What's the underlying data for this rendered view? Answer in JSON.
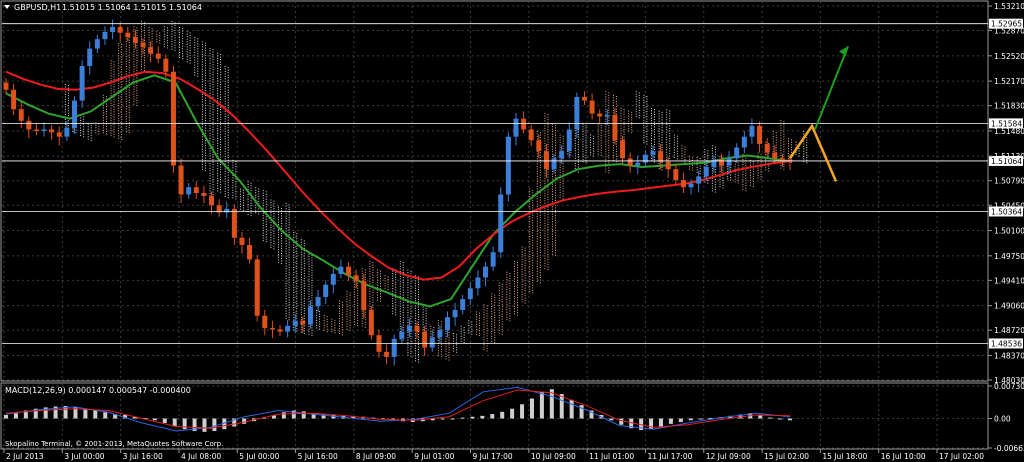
{
  "header": {
    "symbol": "GBPUSD,H1",
    "ohlc": "1.51015 1.51064 1.51015 1.51064",
    "macd": "MACD(12,26,9) 0.000147 0.000547 -0.000400"
  },
  "footer": {
    "copyright": "Skopalino Terminal, © 2001-2013, MetaQuotes Software Corp."
  },
  "colors": {
    "background": "#000000",
    "grid": "#3c3c3c",
    "up_candle": "#3c7fd8",
    "down_candle": "#e0521c",
    "ma_red": "#ee1c1c",
    "ma_green": "#2ea32e",
    "cloud_orange": "#e8b08c",
    "cloud_white": "#dcdcdc",
    "forecast_orange": "#f5a623",
    "arrow_green": "#1ea01e",
    "macd_hist": "#cfcfcf",
    "macd_signal": "#e02020",
    "macd_main": "#2c66e0",
    "level_line": "#ffffff"
  },
  "chart_data": [
    {
      "type": "candlestick",
      "title": "GBPUSD,H1",
      "y_ticks": [
        "1.53210",
        "1.52870",
        "1.52520",
        "1.52170",
        "1.51830",
        "1.51480",
        "1.51130",
        "1.50790",
        "1.50450",
        "1.50100",
        "1.49750",
        "1.49410",
        "1.49060",
        "1.48720",
        "1.48370",
        "1.48030"
      ],
      "ylim": [
        1.4803,
        1.5321
      ],
      "price_labels": [
        "1.52965",
        "1.51584",
        "1.51064",
        "1.50364",
        "1.48536"
      ],
      "x_ticks": [
        "2 Jul 2013",
        "3 Jul 00:00",
        "3 Jul 16:00",
        "4 Jul 08:00",
        "5 Jul 00:00",
        "5 Jul 16:00",
        "8 Jul 09:00",
        "9 Jul 01:00",
        "9 Jul 17:00",
        "10 Jul 09:00",
        "11 Jul 01:00",
        "11 Jul 17:00",
        "12 Jul 09:00",
        "15 Jul 02:00",
        "15 Jul 18:00",
        "16 Jul 10:00",
        "17 Jul 02:00"
      ],
      "close_path": [
        1.5205,
        1.5178,
        1.5162,
        1.515,
        1.5148,
        1.515,
        1.5146,
        1.514,
        1.5152,
        1.519,
        1.5238,
        1.5262,
        1.5275,
        1.5285,
        1.5292,
        1.5284,
        1.5278,
        1.527,
        1.5264,
        1.5255,
        1.5248,
        1.523,
        1.51,
        1.506,
        1.507,
        1.5062,
        1.5058,
        1.5045,
        1.5035,
        1.504,
        1.5,
        1.499,
        1.497,
        1.4892,
        1.4875,
        1.4873,
        1.487,
        1.4878,
        1.4885,
        1.488,
        1.4905,
        1.4918,
        1.4935,
        1.495,
        1.496,
        1.4948,
        1.494,
        1.49,
        1.4865,
        1.4842,
        1.4835,
        1.486,
        1.487,
        1.4878,
        1.487,
        1.4848,
        1.4862,
        1.4872,
        1.489,
        1.49,
        1.4915,
        1.493,
        1.4945,
        1.496,
        1.498,
        1.506,
        1.514,
        1.5165,
        1.515,
        1.5135,
        1.512,
        1.5095,
        1.511,
        1.512,
        1.515,
        1.5195,
        1.519,
        1.5172,
        1.5168,
        1.517,
        1.5135,
        1.511,
        1.51,
        1.5104,
        1.5115,
        1.512,
        1.5105,
        1.5095,
        1.508,
        1.507,
        1.5075,
        1.5085,
        1.5098,
        1.5108,
        1.51,
        1.511,
        1.5125,
        1.514,
        1.5155,
        1.513,
        1.5118,
        1.511,
        1.5108,
        1.5106
      ],
      "ma_red": [
        1.523,
        1.522,
        1.5212,
        1.5206,
        1.5205,
        1.5208,
        1.5215,
        1.5224,
        1.523,
        1.5228,
        1.522,
        1.5206,
        1.519,
        1.517,
        1.5146,
        1.512,
        1.5092,
        1.5064,
        1.5038,
        1.5014,
        1.4992,
        1.4974,
        1.4958,
        1.4948,
        1.4942,
        1.4945,
        1.496,
        1.4985,
        1.5005,
        1.5022,
        1.5034,
        1.5044,
        1.5052,
        1.5057,
        1.5061,
        1.5064,
        1.5066,
        1.5069,
        1.5072,
        1.5075,
        1.508,
        1.5087,
        1.5094,
        1.5099,
        1.5103,
        1.5106
      ],
      "ma_green": [
        1.52,
        1.5185,
        1.5172,
        1.5165,
        1.5175,
        1.5195,
        1.5215,
        1.5225,
        1.5215,
        1.516,
        1.511,
        1.508,
        1.5042,
        1.501,
        1.4985,
        1.4968,
        1.495,
        1.4935,
        1.4924,
        1.4912,
        1.4905,
        1.4915,
        1.496,
        1.5005,
        1.5035,
        1.506,
        1.5082,
        1.5095,
        1.51,
        1.5102,
        1.5098,
        1.51,
        1.5102,
        1.5104,
        1.511,
        1.5114,
        1.511,
        1.5106
      ],
      "forecast": {
        "points": [
          1.511,
          1.5155,
          1.5078
        ],
        "arrow": [
          1.515,
          1.5265
        ]
      }
    },
    {
      "type": "bar",
      "title": "MACD(12,26,9) 0.000147 0.000547 -0.000400",
      "y_ticks": [
        "0.007309",
        "0.00",
        "-0.00663"
      ],
      "ylim": [
        -0.00663,
        0.007309
      ],
      "histogram": [
        0.0008,
        0.0012,
        0.0018,
        0.0022,
        0.0025,
        0.0027,
        0.0028,
        0.0026,
        0.0022,
        0.0018,
        0.0014,
        0.001,
        0.0008,
        0.0004,
        0.0001,
        -0.0004,
        -0.001,
        -0.0018,
        -0.0024,
        -0.0028,
        -0.003,
        -0.0028,
        -0.0024,
        -0.0018,
        -0.0012,
        -0.0006,
        0.0002,
        0.0008,
        0.0014,
        0.0018,
        0.0016,
        0.0012,
        0.001,
        0.0008,
        0.0006,
        0.0005,
        0.0004,
        0.0002,
        -0.0002,
        -0.0004,
        -0.0006,
        -0.0008,
        -0.0006,
        -0.0004,
        -0.0002,
        0.0,
        0.0002,
        0.0004,
        0.0006,
        0.001,
        0.0015,
        0.0022,
        0.0032,
        0.0045,
        0.006,
        0.0066,
        0.0055,
        0.0042,
        0.003,
        0.0018,
        0.0008,
        -0.0004,
        -0.0014,
        -0.0022,
        -0.0026,
        -0.0024,
        -0.0018,
        -0.0012,
        -0.0008,
        -0.0004,
        -0.0002,
        0.0001,
        0.0003,
        0.0006,
        0.0009,
        0.0012,
        0.0008,
        0.0002,
        -0.0002,
        -0.0004
      ],
      "main": [
        0.001,
        0.002,
        0.0026,
        0.0014,
        -0.001,
        -0.0028,
        -0.002,
        0.0004,
        0.0018,
        0.001,
        0.0002,
        -0.0006,
        -0.0002,
        0.0012,
        0.006,
        0.007,
        0.005,
        0.002,
        -0.0016,
        -0.0024,
        -0.001,
        0.0002,
        0.0012,
        0.0004
      ],
      "signal": [
        0.0012,
        0.0018,
        0.0022,
        0.0018,
        0.0,
        -0.0018,
        -0.0022,
        -0.0008,
        0.001,
        0.0012,
        0.0006,
        -0.0002,
        -0.0004,
        0.0004,
        0.004,
        0.0064,
        0.0058,
        0.003,
        -0.0004,
        -0.002,
        -0.0014,
        -0.0002,
        0.0008,
        0.0006
      ]
    }
  ]
}
